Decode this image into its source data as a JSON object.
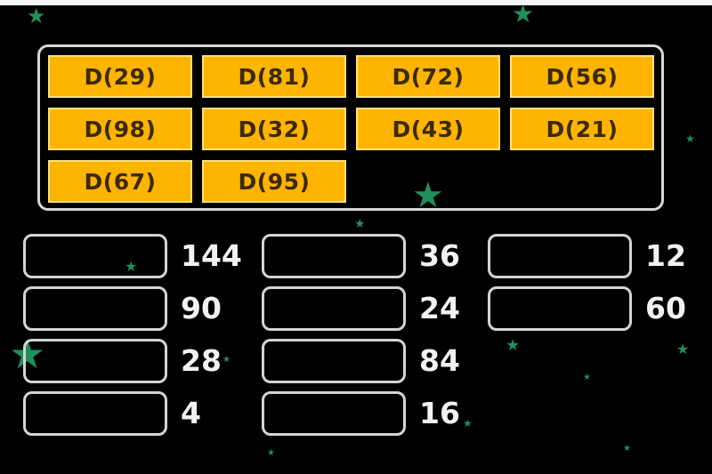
{
  "tiles": [
    "D(29)",
    "D(81)",
    "D(72)",
    "D(56)",
    "D(98)",
    "D(32)",
    "D(43)",
    "D(21)",
    "D(67)",
    "D(95)"
  ],
  "targets": [
    "144",
    "90",
    "28",
    "4",
    "36",
    "24",
    "84",
    "16",
    "12",
    "60"
  ],
  "colors": {
    "background": "#000000",
    "tile": "#ffb400",
    "tile_text": "#3a2a05",
    "border": "#d8d8d8",
    "star": "#1f8f5c"
  }
}
